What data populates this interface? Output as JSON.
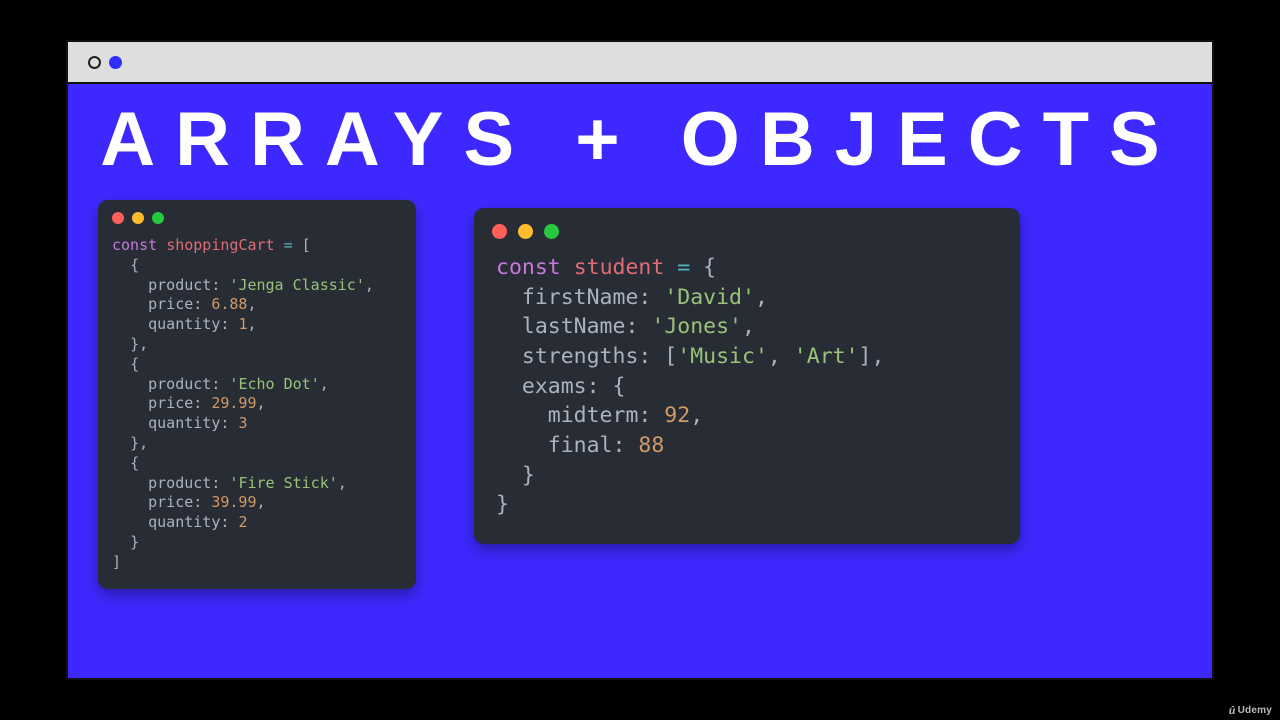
{
  "headline": "ARRAYS + OBJECTS",
  "brand": "Udemy",
  "left": {
    "declKeyword": "const",
    "varName": "shoppingCart",
    "items": [
      {
        "product": "Jenga Classic",
        "price": "6.88",
        "quantity": "1"
      },
      {
        "product": "Echo Dot",
        "price": "29.99",
        "quantity": "3"
      },
      {
        "product": "Fire Stick",
        "price": "39.99",
        "quantity": "2"
      }
    ],
    "keys": {
      "product": "product",
      "price": "price",
      "quantity": "quantity"
    }
  },
  "right": {
    "declKeyword": "const",
    "varName": "student",
    "firstNameKey": "firstName",
    "firstName": "David",
    "lastNameKey": "lastName",
    "lastName": "Jones",
    "strengthsKey": "strengths",
    "strengths": [
      "Music",
      "Art"
    ],
    "examsKey": "exams",
    "midtermKey": "midterm",
    "midterm": "92",
    "finalKey": "final",
    "final": "88"
  }
}
